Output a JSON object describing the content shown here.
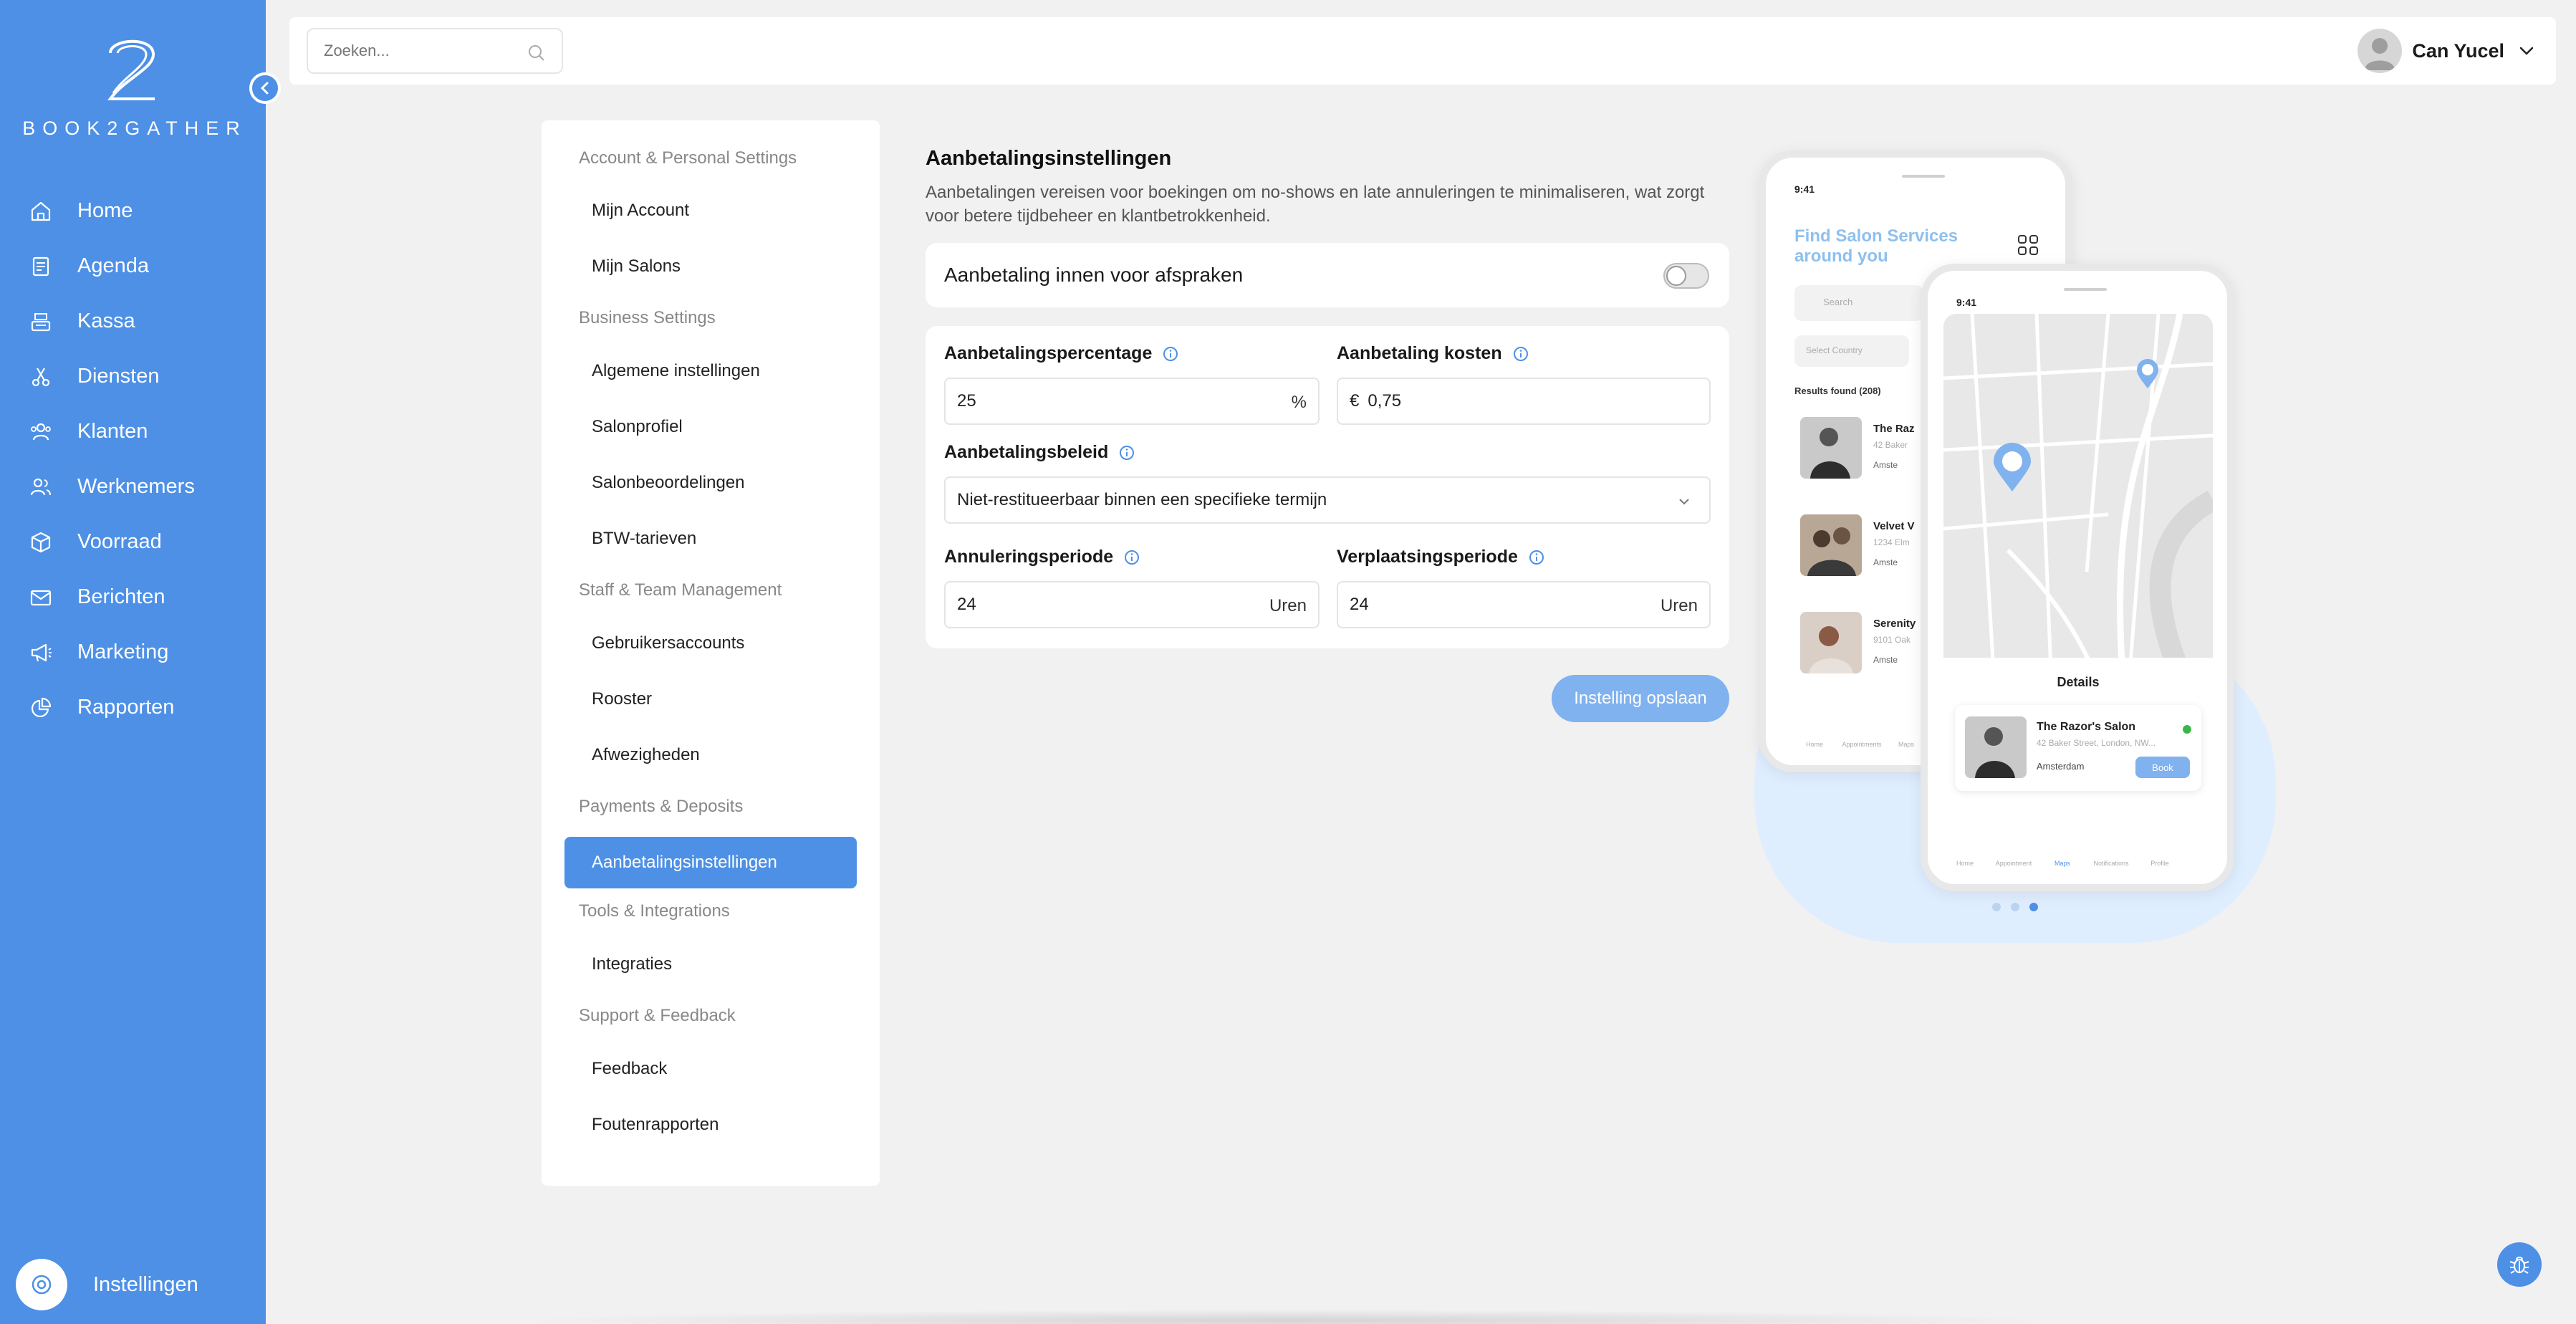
{
  "brand": {
    "logo_text": "BOOK2GATHER",
    "primary_color": "#4d90e6",
    "logo_icon": "numeral-2-logo"
  },
  "sidebar": {
    "items": [
      {
        "label": "Home",
        "icon": "home-icon"
      },
      {
        "label": "Agenda",
        "icon": "agenda-icon"
      },
      {
        "label": "Kassa",
        "icon": "register-icon"
      },
      {
        "label": "Diensten",
        "icon": "scissors-icon"
      },
      {
        "label": "Klanten",
        "icon": "clients-icon"
      },
      {
        "label": "Werknemers",
        "icon": "employees-icon"
      },
      {
        "label": "Voorraad",
        "icon": "box-icon"
      },
      {
        "label": "Berichten",
        "icon": "mail-icon"
      },
      {
        "label": "Marketing",
        "icon": "megaphone-icon"
      },
      {
        "label": "Rapporten",
        "icon": "pie-chart-icon"
      }
    ],
    "settings_label": "Instellingen"
  },
  "topbar": {
    "search_placeholder": "Zoeken...",
    "user_name": "Can Yucel"
  },
  "settings_nav": {
    "sections": [
      {
        "header": "Account & Personal Settings",
        "items": [
          "Mijn Account",
          "Mijn Salons"
        ]
      },
      {
        "header": "Business Settings",
        "items": [
          "Algemene instellingen",
          "Salonprofiel",
          "Salonbeoordelingen",
          "BTW-tarieven"
        ]
      },
      {
        "header": "Staff & Team Management",
        "items": [
          "Gebruikersaccounts",
          "Rooster",
          "Afwezigheden"
        ]
      },
      {
        "header": "Payments & Deposits",
        "items": [
          "Aanbetalingsinstellingen"
        ]
      },
      {
        "header": "Tools & Integrations",
        "items": [
          "Integraties"
        ]
      },
      {
        "header": "Support & Feedback",
        "items": [
          "Feedback",
          "Foutenrapporten"
        ]
      }
    ],
    "active_item": "Aanbetalingsinstellingen"
  },
  "main": {
    "title": "Aanbetalingsinstellingen",
    "description": "Aanbetalingen vereisen voor boekingen om no-shows en late annuleringen te minimaliseren, wat zorgt voor betere tijdbeheer en klantbetrokkenheid.",
    "toggle": {
      "label": "Aanbetaling innen voor afspraken",
      "on": false
    },
    "fields": {
      "percentage": {
        "label": "Aanbetalingspercentage",
        "value": "25",
        "suffix": "%"
      },
      "cost": {
        "label": "Aanbetaling kosten",
        "prefix": "€",
        "value": "0,75"
      },
      "policy": {
        "label": "Aanbetalingsbeleid",
        "value": "Niet-restitueerbaar binnen een specifieke termijn"
      },
      "cancellation": {
        "label": "Annuleringsperiode",
        "value": "24",
        "suffix": "Uren"
      },
      "reschedule": {
        "label": "Verplaatsingsperiode",
        "value": "24",
        "suffix": "Uren"
      }
    },
    "save_label": "Instelling opslaan"
  },
  "illustration": {
    "phone1": {
      "time": "9:41",
      "title": "Find Salon Services around you",
      "search": "Search",
      "select": "Select Country",
      "results": "Results found (208)",
      "list": [
        {
          "title": "The Raz",
          "sub": "42 Baker",
          "loc": "Amste"
        },
        {
          "title": "Velvet V",
          "sub": "1234 Elm",
          "loc": "Amste"
        },
        {
          "title": "Serenity",
          "sub": "9101 Oak",
          "loc": "Amste"
        }
      ],
      "tabs": [
        "Home",
        "Appointments",
        "Maps"
      ]
    },
    "phone2": {
      "time": "9:41",
      "details_title": "Details",
      "card": {
        "name": "The Razor's Salon",
        "address": "42 Baker Street, London, NW...",
        "city": "Amsterdam",
        "book": "Book"
      },
      "tabs": [
        "Home",
        "Appointment",
        "Maps",
        "Notifications",
        "Profile"
      ]
    },
    "carousel_active": 3,
    "carousel_total": 3
  }
}
